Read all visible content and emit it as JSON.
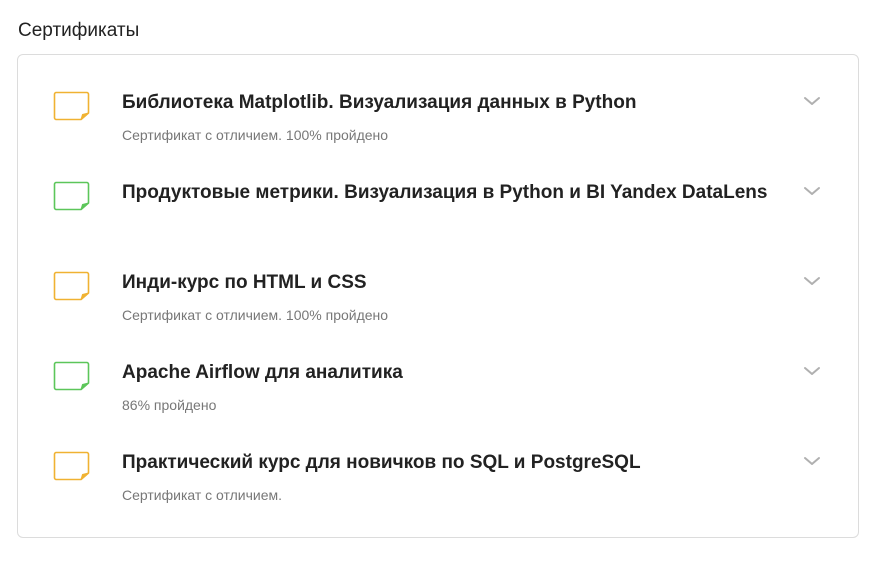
{
  "section": {
    "title": "Сертификаты"
  },
  "colors": {
    "orange": "#f0b232",
    "green": "#5cc65a",
    "chevron": "#b0b0b0"
  },
  "certificates": [
    {
      "title": "Библиотека Matplotlib. Визуализация данных в Python",
      "subtitle": "Сертификат с отличием. 100% пройдено",
      "icon": "certificate-orange-icon",
      "color": "orange"
    },
    {
      "title": "Продуктовые метрики. Визуализация в Python и BI Yandex DataLens",
      "subtitle": "",
      "icon": "certificate-green-icon",
      "color": "green"
    },
    {
      "title": "Инди-курс по HTML и CSS",
      "subtitle": "Сертификат с отличием. 100% пройдено",
      "icon": "certificate-orange-icon",
      "color": "orange"
    },
    {
      "title": "Apache Airflow для аналитика",
      "subtitle": "86% пройдено",
      "icon": "certificate-green-icon",
      "color": "green"
    },
    {
      "title": "Практический курс для новичков по SQL и PostgreSQL",
      "subtitle": "Сертификат с отличием.",
      "icon": "certificate-orange-icon",
      "color": "orange"
    }
  ]
}
